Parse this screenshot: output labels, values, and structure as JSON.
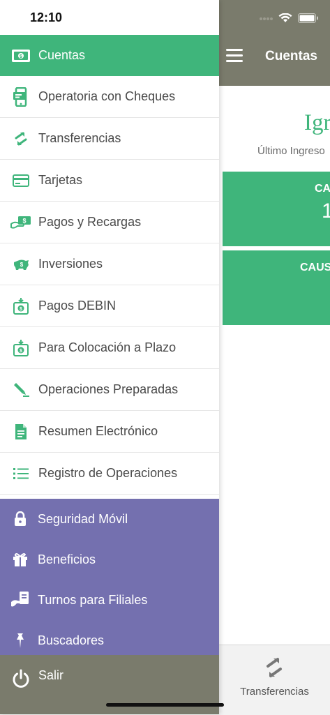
{
  "status_bar": {
    "time": "12:10"
  },
  "header": {
    "title": "Cuentas"
  },
  "content": {
    "title_partial": "Igr",
    "ultimo_partial": "Último Ingreso",
    "card1_label_partial": "CA",
    "card1_value_partial": "1",
    "card2_label_partial": "CAUS"
  },
  "bottom_tab": {
    "label": "Transferencias"
  },
  "menu": {
    "items": [
      {
        "label": "Cuentas",
        "icon": "cash-icon"
      },
      {
        "label": "Operatoria con Cheques",
        "icon": "check-phone-icon"
      },
      {
        "label": "Transferencias",
        "icon": "transfer-arrows-icon"
      },
      {
        "label": "Tarjetas",
        "icon": "credit-card-icon"
      },
      {
        "label": "Pagos y Recargas",
        "icon": "payment-hand-icon"
      },
      {
        "label": "Inversiones",
        "icon": "piggy-bank-icon"
      },
      {
        "label": "Pagos DEBIN",
        "icon": "debin-icon"
      },
      {
        "label": "Para Colocación a Plazo",
        "icon": "deposit-icon"
      },
      {
        "label": "Operaciones Preparadas",
        "icon": "pencil-icon"
      },
      {
        "label": "Resumen Electrónico",
        "icon": "document-icon"
      },
      {
        "label": "Registro de Operaciones",
        "icon": "list-icon"
      }
    ],
    "secondary": [
      {
        "label": "Seguridad Móvil",
        "icon": "lock-icon"
      },
      {
        "label": "Beneficios",
        "icon": "gift-icon"
      },
      {
        "label": "Turnos para Filiales",
        "icon": "appointment-icon"
      },
      {
        "label": "Buscadores",
        "icon": "pin-icon"
      }
    ],
    "logout": {
      "label": "Salir",
      "icon": "power-icon"
    }
  },
  "colors": {
    "accent_green": "#3fb57b",
    "drawer_purple": "#7470af",
    "header_gray": "#7a7b6c"
  }
}
